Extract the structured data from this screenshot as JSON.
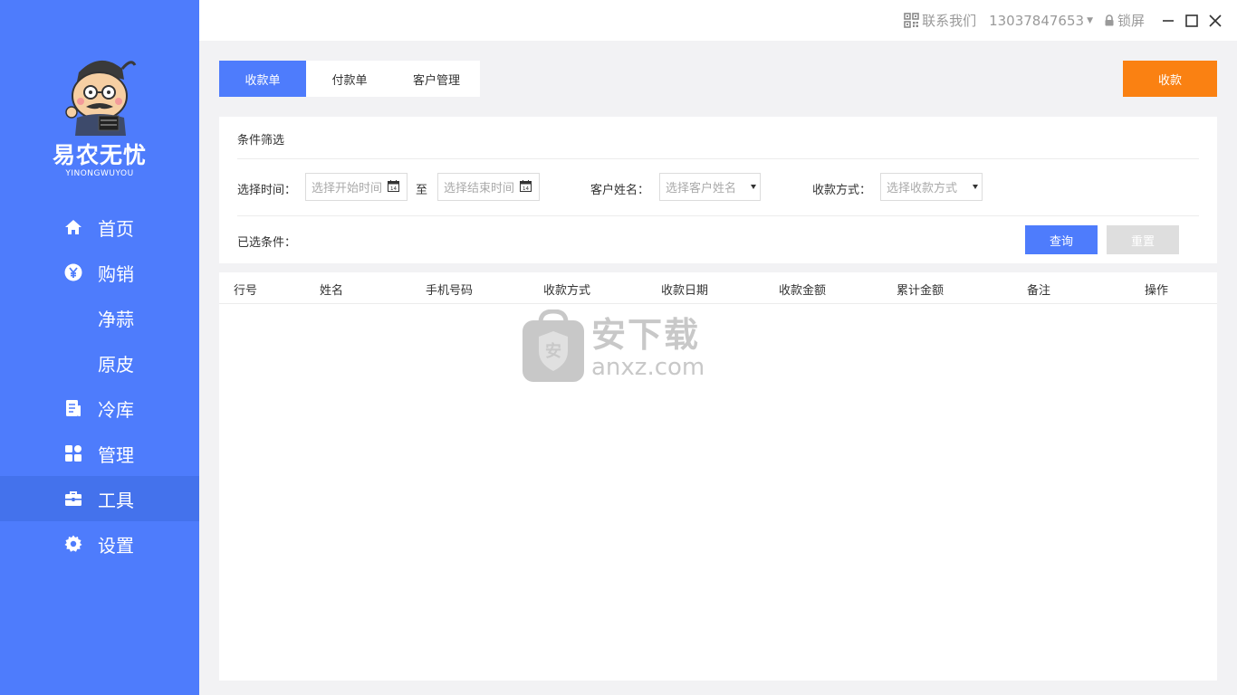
{
  "brand": {
    "name": "易农无忧",
    "subtitle": "YINONGWUYOU"
  },
  "sidebar": {
    "items": [
      {
        "label": "首页",
        "icon": "home-icon"
      },
      {
        "label": "购销",
        "icon": "yen-icon"
      },
      {
        "label": "净蒜"
      },
      {
        "label": "原皮"
      },
      {
        "label": "冷库",
        "icon": "document-icon"
      },
      {
        "label": "管理",
        "icon": "grid-icon"
      },
      {
        "label": "工具",
        "icon": "briefcase-icon",
        "active": true
      },
      {
        "label": "设置",
        "icon": "gear-icon"
      }
    ]
  },
  "topbar": {
    "contact": "联系我们",
    "phone": "13037847653",
    "lock": "锁屏"
  },
  "tabs": [
    {
      "label": "收款单",
      "active": true
    },
    {
      "label": "付款单"
    },
    {
      "label": "客户管理"
    }
  ],
  "actions": {
    "receive": "收款"
  },
  "filter": {
    "title": "条件筛选",
    "time_label": "选择时间：",
    "start_placeholder": "选择开始时间",
    "to": "至",
    "end_placeholder": "选择结束时间",
    "customer_label": "客户姓名：",
    "customer_placeholder": "选择客户姓名",
    "method_label": "收款方式：",
    "method_placeholder": "选择收款方式",
    "selected_label": "已选条件：",
    "query": "查询",
    "reset": "重置"
  },
  "table": {
    "columns": [
      "行号",
      "姓名",
      "手机号码",
      "收款方式",
      "收款日期",
      "收款金额",
      "累计金额",
      "备注",
      "操作"
    ],
    "rows": []
  },
  "watermark": {
    "text": "安下载",
    "url": "anxz.com"
  },
  "colors": {
    "primary": "#4e7cfc",
    "accent": "#fa8112"
  }
}
